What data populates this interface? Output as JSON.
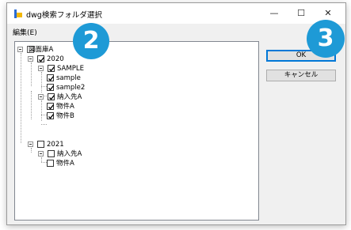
{
  "window": {
    "title": "dwg検索フォルダ選択",
    "minimize_glyph": "—",
    "maximize_glyph": "☐",
    "close_glyph": "✕"
  },
  "menu": {
    "edit_label": "編集(E)"
  },
  "tree": {
    "root": {
      "label": "図面庫A"
    },
    "nodes": [
      {
        "label": "2020",
        "checked": true
      },
      {
        "label": "SAMPLE",
        "checked": true
      },
      {
        "label": "sample",
        "checked": true
      },
      {
        "label": "sample2",
        "checked": true
      },
      {
        "label": "納入先A",
        "checked": true
      },
      {
        "label": "物件A",
        "checked": true
      },
      {
        "label": "物件B",
        "checked": true
      },
      {
        "label": "2021",
        "checked": false
      },
      {
        "label": "納入先A",
        "checked": false
      },
      {
        "label": "物件A",
        "checked": false
      }
    ]
  },
  "buttons": {
    "ok": "OK",
    "cancel": "キャンセル"
  },
  "badges": {
    "left": "2",
    "right": "3"
  },
  "colors": {
    "badge": "#1e9ad6",
    "default_button_border": "#0078d7"
  }
}
